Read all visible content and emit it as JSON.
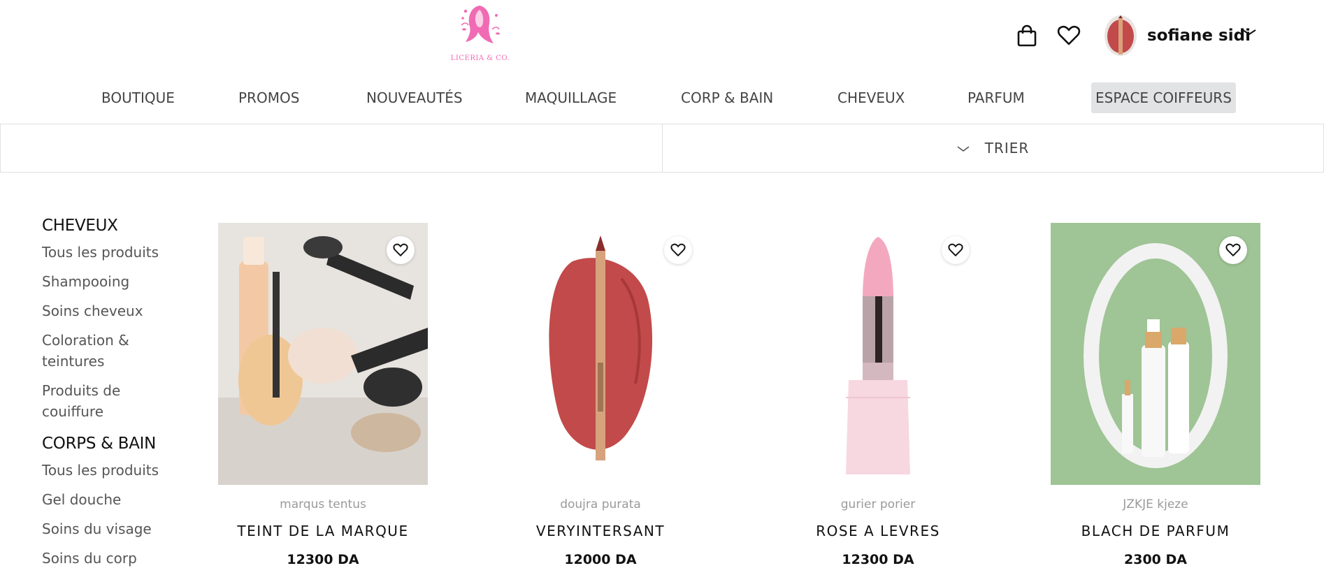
{
  "header": {
    "logo_text": "LICERIA & CO.",
    "user_name": "sofiane sidi"
  },
  "nav": {
    "items": [
      {
        "label": "BOUTIQUE"
      },
      {
        "label": "PROMOS"
      },
      {
        "label": "NOUVEAUTÉS"
      },
      {
        "label": "MAQUILLAGE"
      },
      {
        "label": "CORP & BAIN"
      },
      {
        "label": "CHEVEUX"
      },
      {
        "label": "PARFUM"
      },
      {
        "label": "ESPACE COIFFEURS"
      }
    ],
    "active_index": 7
  },
  "sort": {
    "label": "TRIER"
  },
  "sidebar": {
    "sections": [
      {
        "title": "CHEVEUX",
        "items": [
          "Tous les produits",
          "Shampooing",
          "Soins cheveux",
          "Coloration & teintures",
          "Produits de couiffure"
        ]
      },
      {
        "title": "CORPS & BAIN",
        "items": [
          "Tous les produits",
          "Gel douche",
          "Soins du visage",
          "Soins du corp"
        ]
      }
    ]
  },
  "products": [
    {
      "brand": "marqus tentus",
      "name": "TEINT DE LA MARQUE",
      "price": "12300 DA"
    },
    {
      "brand": "doujra purata",
      "name": "VERYINTERSANT",
      "price": "12000 DA"
    },
    {
      "brand": "gurier porier",
      "name": "ROSE A LEVRES",
      "price": "12300 DA"
    },
    {
      "brand": "JZKJE kjeze",
      "name": "BLACH DE PARFUM",
      "price": "2300 DA"
    }
  ],
  "colors": {
    "brand_pink": "#f06bb4",
    "active_nav_bg": "#e2e3e5",
    "parfum_bg": "#9fc495"
  },
  "icons": {
    "bag": "shopping-bag-icon",
    "wishlist": "heart-icon",
    "user_menu": "chevron-down-icon",
    "sort": "chevron-down-icon"
  }
}
